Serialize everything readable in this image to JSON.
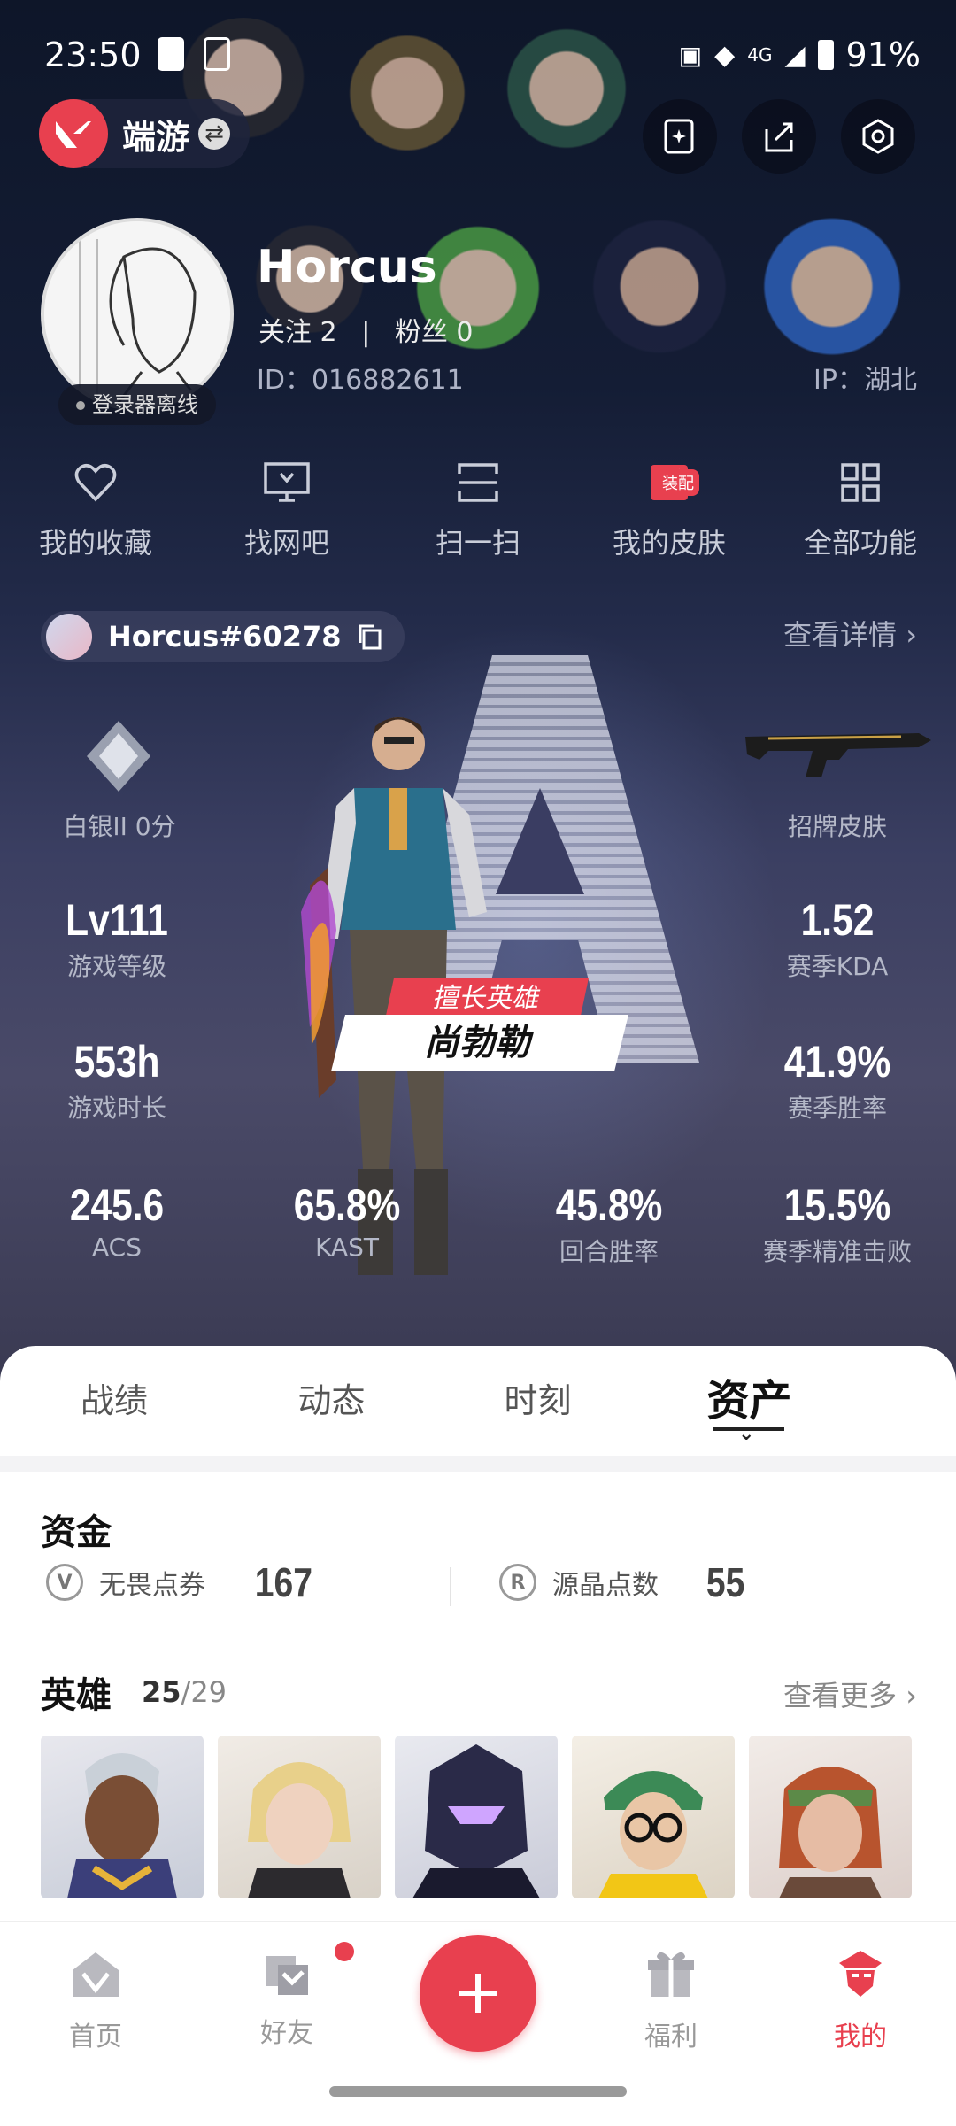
{
  "status": {
    "time": "23:50",
    "battery": "91%",
    "network": "4G"
  },
  "header": {
    "brand": "端游"
  },
  "profile": {
    "name": "Horcus",
    "follow_label": "关注",
    "follow_count": "2",
    "separator": "|",
    "fans_label": "粉丝",
    "fans_count": "0",
    "id": "ID：016882611",
    "ip": "IP：湖北",
    "status_badge": "登录器离线"
  },
  "quick_actions": [
    {
      "label": "我的收藏",
      "icon": "heart-icon"
    },
    {
      "label": "找网吧",
      "icon": "monitor-icon"
    },
    {
      "label": "扫一扫",
      "icon": "scan-icon"
    },
    {
      "label": "我的皮肤",
      "icon": "skin-icon",
      "badge": "装配"
    },
    {
      "label": "全部功能",
      "icon": "grid-icon"
    }
  ],
  "riot_id": "Horcus#60278",
  "view_details": "查看详情",
  "stats": {
    "rank": "白银II 0分",
    "skin_label": "招牌皮肤",
    "level": {
      "value": "Lv111",
      "label": "游戏等级"
    },
    "kda": {
      "value": "1.52",
      "label": "赛季KDA"
    },
    "hours": {
      "value": "553h",
      "label": "游戏时长"
    },
    "winrate": {
      "value": "41.9%",
      "label": "赛季胜率"
    },
    "acs": {
      "value": "245.6",
      "label": "ACS"
    },
    "kast": {
      "value": "65.8%",
      "label": "KAST"
    },
    "round_winrate": {
      "value": "45.8%",
      "label": "回合胜率"
    },
    "headshot": {
      "value": "15.5%",
      "label": "赛季精准击败"
    },
    "best_agent_tag": "擅长英雄",
    "best_agent": "尚勃勒"
  },
  "tabs": [
    {
      "label": "战绩"
    },
    {
      "label": "动态"
    },
    {
      "label": "时刻"
    },
    {
      "label": "资产"
    }
  ],
  "assets": {
    "funds_title": "资金",
    "vp_label": "无畏点券",
    "vp_value": "167",
    "rp_label": "源晶点数",
    "rp_value": "55",
    "agents_title": "英雄",
    "agents_owned": "25",
    "agents_total": "/29",
    "see_more": "查看更多"
  },
  "nav": [
    {
      "label": "首页"
    },
    {
      "label": "好友"
    },
    {
      "label": "福利"
    },
    {
      "label": "我的"
    }
  ],
  "colors": {
    "accent": "#e8404f",
    "hero_bg": "#141d35"
  }
}
